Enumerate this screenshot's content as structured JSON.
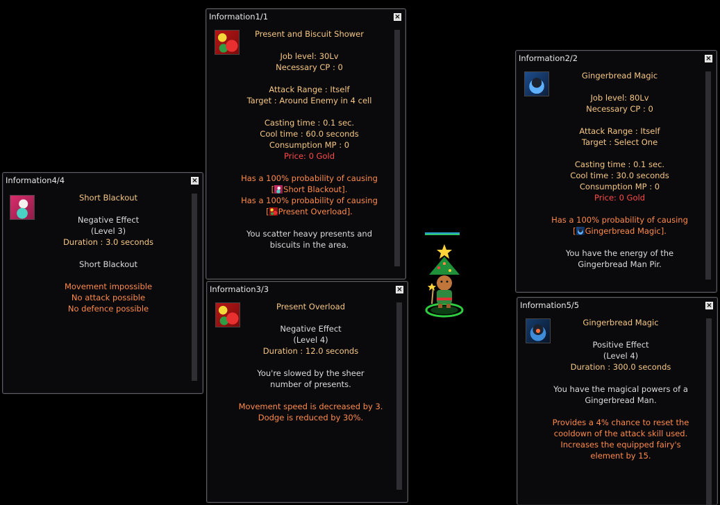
{
  "windows": {
    "w1": {
      "title": "Information1/1",
      "skill_name": "Present and Biscuit Shower",
      "job_level": "Job level: 30Lv",
      "cp": "Necessary CP : 0",
      "range": "Attack Range : Itself",
      "target": "Target : Around Enemy in 4 cell",
      "cast": "Casting time : 0.1 sec.",
      "cool": "Cool time : 60.0 seconds",
      "mp": "Consumption MP : 0",
      "price": "Price: 0 Gold",
      "prob1": "Has a 100% probability of causing",
      "link1_open": "[",
      "link1_name": "Short Blackout",
      "link1_close": "].",
      "prob2": "Has a 100% probability of causing",
      "link2_open": "[",
      "link2_name": "Present Overload",
      "link2_close": "].",
      "desc1": "You scatter heavy presents and",
      "desc2": "biscuits in the area."
    },
    "w2": {
      "title": "Information2/2",
      "skill_name": "Gingerbread Magic",
      "job_level": "Job level: 80Lv",
      "cp": "Necessary CP : 0",
      "range": "Attack Range : Itself",
      "target": "Target : Select One",
      "cast": "Casting time : 0.1 sec.",
      "cool": "Cool time : 30.0 seconds",
      "mp": "Consumption MP : 0",
      "price": "Price: 0 Gold",
      "prob1": "Has a 100% probability of causing",
      "link1_open": "[",
      "link1_name": "Gingerbread Magic",
      "link1_close": "].",
      "desc1": "You have the energy of the",
      "desc2": "Gingerbread Man Pir."
    },
    "w3": {
      "title": "Information3/3",
      "skill_name": "Present Overload",
      "effect": "Negative Effect",
      "level": "(Level 4)",
      "duration": "Duration : 12.0 seconds",
      "desc1": "You're slowed by the sheer",
      "desc2": "number of presents.",
      "fx1": "Movement speed is decreased by 3.",
      "fx2": "Dodge is reduced by 30%."
    },
    "w4": {
      "title": "Information4/4",
      "skill_name": "Short Blackout",
      "effect": "Negative Effect",
      "level": "(Level 3)",
      "duration": "Duration : 3.0 seconds",
      "desc1": "Short Blackout",
      "fx1": "Movement impossible",
      "fx2": "No attack possible",
      "fx3": "No defence possible"
    },
    "w5": {
      "title": "Information5/5",
      "skill_name": "Gingerbread Magic",
      "effect": "Positive Effect",
      "level": "(Level 4)",
      "duration": "Duration : 300.0 seconds",
      "desc1": "You have the magical powers of a",
      "desc2": "Gingerbread Man.",
      "fx1": "Provides a 4% chance to reset the",
      "fx2": "cooldown of the attack skill used.",
      "fx3": "Increases the equipped fairy's",
      "fx4": "element by 15."
    }
  },
  "icons": {
    "close": "×",
    "close_icon_name": "close-icon",
    "skill_icons": [
      "present-biscuit-icon",
      "gingerbread-magic-icon",
      "present-overload-icon",
      "short-blackout-icon",
      "gingerbread-buff-icon"
    ]
  },
  "colors": {
    "heading": "#f6c784",
    "text": "#dcdcdc",
    "price": "#ff4a4a",
    "effect": "#ff8a4c",
    "background": "#000000"
  }
}
